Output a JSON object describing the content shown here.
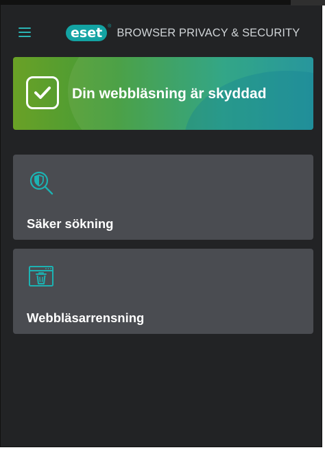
{
  "header": {
    "logo_text": "eset",
    "logo_reg": "®",
    "product_name": "BROWSER PRIVACY & SECURITY",
    "accent_color": "#13a3a3"
  },
  "status": {
    "message": "Din webbläsning är skyddad",
    "icon": "checkmark-icon",
    "color": "#3f9a3a"
  },
  "features": [
    {
      "label": "Säker sökning",
      "icon": "secure-search-icon"
    },
    {
      "label": "Webbläsarrensning",
      "icon": "browser-cleanup-icon"
    }
  ]
}
